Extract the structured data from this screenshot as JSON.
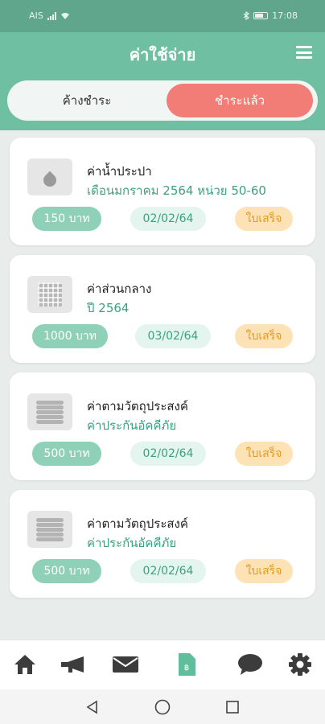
{
  "status_bar": {
    "carrier": "AIS",
    "time": "17:08"
  },
  "header": {
    "title": "ค่าใช้จ่าย",
    "menu_icon": "hamburger-menu-icon"
  },
  "tabs": [
    {
      "label": "ค้างชำระ",
      "active": false
    },
    {
      "label": "ชำระแล้ว",
      "active": true
    }
  ],
  "colors": {
    "header": "#6fc0a3",
    "status_bar": "#5fa68c",
    "active_tab": "#f27d76",
    "amount_pill": "#8fd0b9",
    "date_pill": "#e4f4ee",
    "receipt_pill": "#fde2b6",
    "nav_active": "#5fbf9c"
  },
  "bills": [
    {
      "icon": "water-drop-icon",
      "title": "ค่าน้ำประปา",
      "subtitle": "เดือนมกราคม 2564 หน่วย 50-60",
      "amount": "150 บาท",
      "date": "02/02/64",
      "receipt": "ใบเสร็จ"
    },
    {
      "icon": "building-icon",
      "title": "ค่าส่วนกลาง",
      "subtitle": "ปี 2564",
      "amount": "1000 บาท",
      "date": "03/02/64",
      "receipt": "ใบเสร็จ"
    },
    {
      "icon": "coins-icon",
      "title": "ค่าตามวัตถุประสงค์",
      "subtitle": "ค่าประกันอัคคีภัย",
      "amount": "500 บาท",
      "date": "02/02/64",
      "receipt": "ใบเสร็จ"
    },
    {
      "icon": "coins-icon",
      "title": "ค่าตามวัตถุประสงค์",
      "subtitle": "ค่าประกันอัคคีภัย",
      "amount": "500 บาท",
      "date": "02/02/64",
      "receipt": "ใบเสร็จ"
    }
  ],
  "bottom_nav": [
    {
      "icon": "home-icon",
      "active": false
    },
    {
      "icon": "megaphone-icon",
      "active": false
    },
    {
      "icon": "mail-icon",
      "active": false
    },
    {
      "icon": "bill-document-icon",
      "active": true
    },
    {
      "icon": "chat-bubble-icon",
      "active": false
    },
    {
      "icon": "settings-gear-icon",
      "active": false
    }
  ]
}
